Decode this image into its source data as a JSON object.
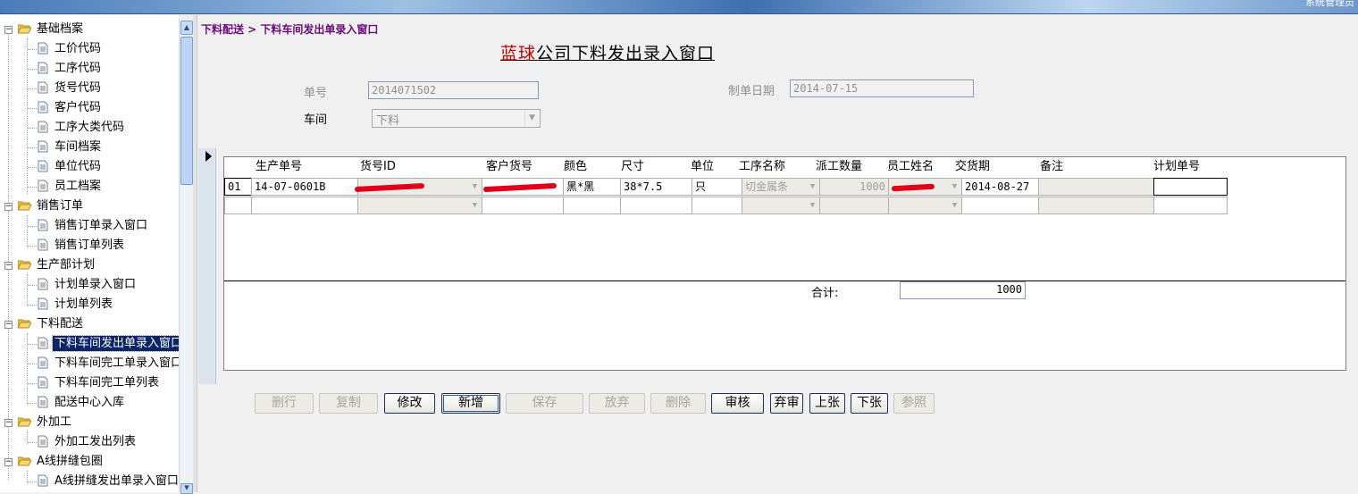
{
  "app": {
    "user_text": "系统管理员"
  },
  "tree": {
    "groups": [
      {
        "label": "基础档案",
        "items": [
          "工价代码",
          "工序代码",
          "货号代码",
          "客户代码",
          "工序大类代码",
          "车间档案",
          "单位代码",
          "员工档案"
        ]
      },
      {
        "label": "销售订单",
        "items": [
          "销售订单录入窗口",
          "销售订单列表"
        ]
      },
      {
        "label": "生产部计划",
        "items": [
          "计划单录入窗口",
          "计划单列表"
        ]
      },
      {
        "label": "下料配送",
        "items": [
          "下料车间发出单录入窗口",
          "下料车间完工单录入窗口",
          "下料车间完工单列表",
          "配送中心入库"
        ]
      },
      {
        "label": "外加工",
        "items": [
          "外加工发出列表"
        ]
      },
      {
        "label": "A线拼缝包圈",
        "items": [
          "A线拼缝发出单录入窗口"
        ]
      }
    ],
    "selected": "下料车间发出单录入窗口"
  },
  "breadcrumb": "下料配送 > 下料车间发出单录入窗口",
  "title": {
    "redacted_prefix": "蓝球",
    "main": "公司下料发出录入窗口"
  },
  "form": {
    "order_no_label": "单号",
    "order_no_value": "2014071502",
    "date_label": "制单日期",
    "date_value": "2014-07-15",
    "workshop_label": "车间",
    "workshop_value": "下料"
  },
  "grid": {
    "headers": [
      "生产单号",
      "货号ID",
      "客户货号",
      "颜色",
      "尺寸",
      "单位",
      "工序名称",
      "派工数量",
      "员工姓名",
      "交货期",
      "备注",
      "计划单号"
    ],
    "rows": [
      {
        "row_no": "01",
        "prod_no": "14-07-0601B",
        "color": "黑*黑",
        "size": "38*7.5",
        "unit": "只",
        "process": "切金属条",
        "qty": "1000",
        "delivery": "2014-08-27"
      }
    ],
    "total_label": "合计:",
    "total_value": "1000"
  },
  "buttons": {
    "delete_row": "删行",
    "copy": "复制",
    "edit": "修改",
    "add": "新增",
    "save": "保存",
    "discard": "放弃",
    "delete": "删除",
    "audit": "审核",
    "unaudit": "弃审",
    "prev": "上张",
    "next": "下张",
    "ref": "参照"
  },
  "colors": {
    "breadcrumb": "#6b0a7a",
    "selection": "#0a246a",
    "redaction": "#e0001c"
  }
}
